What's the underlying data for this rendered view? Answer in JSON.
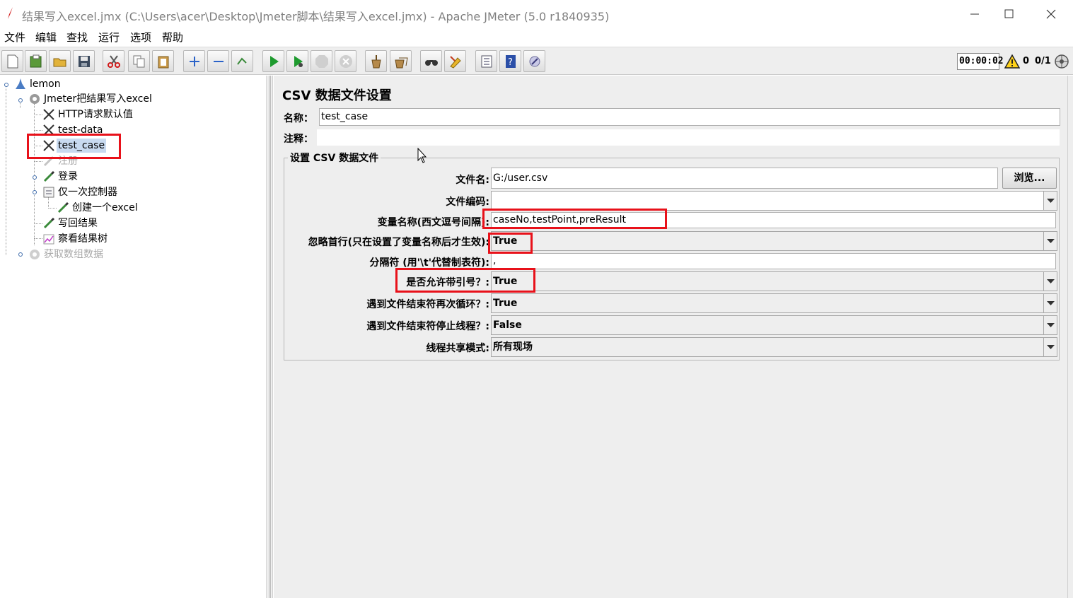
{
  "window": {
    "title": "结果写入excel.jmx (C:\\Users\\acer\\Desktop\\Jmeter脚本\\结果写入excel.jmx) - Apache JMeter (5.0 r1840935)"
  },
  "menu": [
    "文件",
    "编辑",
    "查找",
    "运行",
    "选项",
    "帮助"
  ],
  "toolbar": {
    "buttons": [
      "new-icon",
      "templates-icon",
      "open-icon",
      "save-icon",
      "cut-icon",
      "copy-icon",
      "paste-icon",
      "expand-icon",
      "collapse-icon",
      "toggle-icon",
      "start-icon",
      "start-no-pause-icon",
      "stop-icon",
      "shutdown-icon",
      "clear-icon",
      "clear-all-icon",
      "search-icon",
      "reset-search-icon",
      "function-helper-icon",
      "help-icon",
      "remote-icon"
    ],
    "timer": "00:00:02",
    "error_count": "0",
    "threads": "0/1"
  },
  "tree": {
    "nodes": [
      {
        "label": "lemon"
      },
      {
        "label": "Jmeter把结果写入excel"
      },
      {
        "label": "HTTP请求默认值"
      },
      {
        "label": "test-data"
      },
      {
        "label": "test_case"
      },
      {
        "label": "注册"
      },
      {
        "label": "登录"
      },
      {
        "label": "仅一次控制器"
      },
      {
        "label": "创建一个excel"
      },
      {
        "label": "写回结果"
      },
      {
        "label": "察看结果树"
      },
      {
        "label": "获取数组数据"
      }
    ]
  },
  "panel": {
    "title": "CSV 数据文件设置",
    "name_label": "名称：",
    "name_value": "test_case",
    "comment_label": "注释：",
    "group_title": "设置 CSV 数据文件",
    "file_label": "文件名:",
    "file_value": "G:/user.csv",
    "browse_label": "浏览...",
    "encoding_label": "文件编码:",
    "encoding_value": "",
    "varnames_label": "变量名称(西文逗号间隔):",
    "varnames_value": "caseNo,testPoint,preResult",
    "ignore_first_label": "忽略首行(只在设置了变量名称后才生效):",
    "ignore_first_value": "True",
    "delimiter_label": "分隔符 (用'\\t'代替制表符):",
    "delimiter_value": ",",
    "quoted_label": "是否允许带引号？:",
    "quoted_value": "True",
    "recycle_label": "遇到文件结束符再次循环？:",
    "recycle_value": "True",
    "stop_thread_label": "遇到文件结束符停止线程？:",
    "stop_thread_value": "False",
    "share_mode_label": "线程共享模式:",
    "share_mode_value": "所有现场"
  },
  "colors": {
    "highlight": "#e8111a",
    "selection": "#c8daf0",
    "panel_bg": "#eeeeee"
  }
}
